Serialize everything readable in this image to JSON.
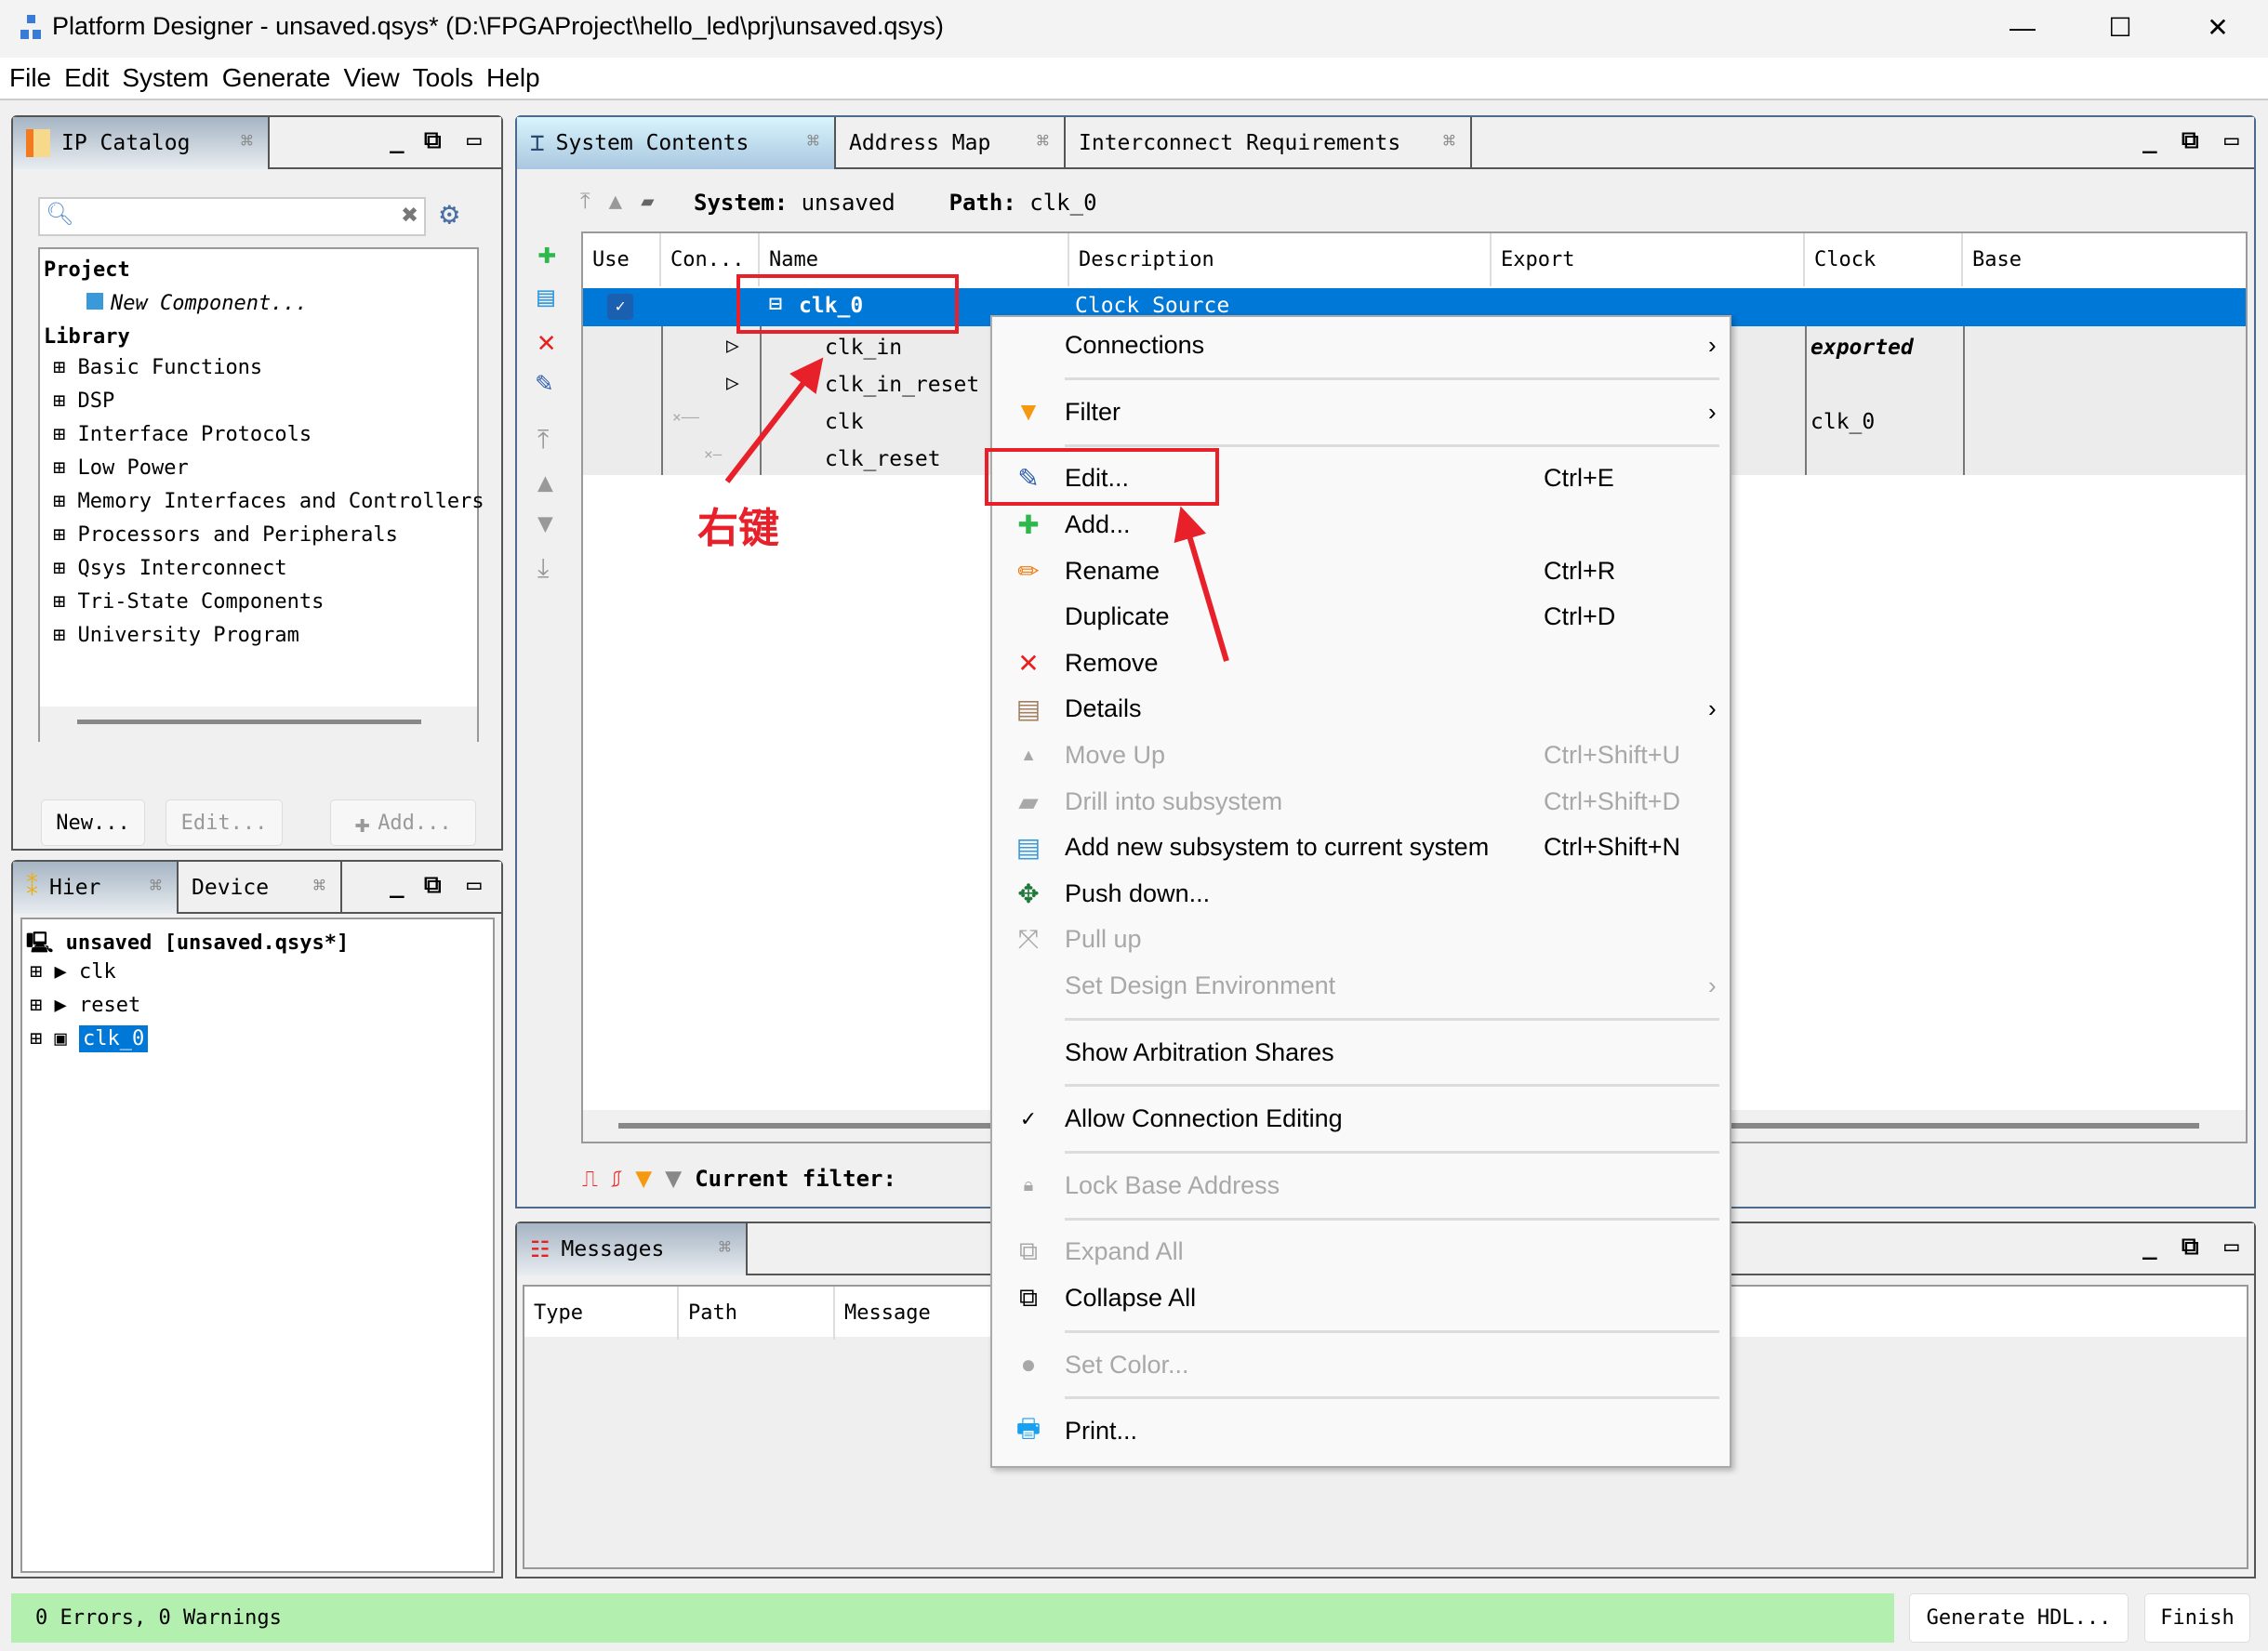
{
  "window": {
    "title": "Platform Designer - unsaved.qsys* (D:\\FPGAProject\\hello_led\\prj\\unsaved.qsys)",
    "minimize": "—",
    "maximize": "☐",
    "close": "✕"
  },
  "menubar": [
    "File",
    "Edit",
    "System",
    "Generate",
    "View",
    "Tools",
    "Help"
  ],
  "ip_catalog": {
    "tab": "IP Catalog",
    "search_placeholder": "",
    "tree": [
      {
        "label": "Project",
        "bold": true
      },
      {
        "label": "New Component...",
        "italic": true
      },
      {
        "label": "Library",
        "bold": true
      },
      {
        "label": "Basic Functions"
      },
      {
        "label": "DSP"
      },
      {
        "label": "Interface Protocols"
      },
      {
        "label": "Low Power"
      },
      {
        "label": "Memory Interfaces and Controllers"
      },
      {
        "label": "Processors and Peripherals"
      },
      {
        "label": "Qsys Interconnect"
      },
      {
        "label": "Tri-State Components"
      },
      {
        "label": "University Program"
      }
    ],
    "buttons": {
      "new": "New...",
      "edit": "Edit...",
      "add": "Add..."
    }
  },
  "hierarchy": {
    "tabs": [
      "Hier",
      "Device"
    ],
    "root": "unsaved [unsaved.qsys*]",
    "items": [
      "clk",
      "reset",
      "clk_0"
    ],
    "selected": "clk_0"
  },
  "system_contents": {
    "tabs": [
      "System Contents",
      "Address Map",
      "Interconnect Requirements"
    ],
    "system_label": "System:",
    "system_value": "unsaved",
    "path_label": "Path:",
    "path_value": "clk_0",
    "columns": [
      "Use",
      "Con...",
      "Name",
      "Description",
      "Export",
      "Clock",
      "Base"
    ],
    "rows": [
      {
        "name": "clk_0",
        "description": "Clock Source",
        "export": "",
        "clock": "",
        "selected": true,
        "use": true
      },
      {
        "name": "clk_in",
        "description": "",
        "export": "",
        "clock": "exported"
      },
      {
        "name": "clk_in_reset",
        "description": "",
        "export": "",
        "clock": ""
      },
      {
        "name": "clk",
        "description": "",
        "export": "",
        "clock": "clk_0"
      },
      {
        "name": "clk_reset",
        "description": "",
        "export": "",
        "clock": ""
      }
    ],
    "filter_label": "Current filter:"
  },
  "messages": {
    "tab": "Messages",
    "columns": [
      "Type",
      "Path",
      "Message"
    ]
  },
  "status": {
    "text": "0 Errors, 0 Warnings",
    "generate": "Generate HDL...",
    "finish": "Finish",
    "color": "#b3f0b0"
  },
  "context_menu": [
    {
      "label": "Connections",
      "submenu": true
    },
    {
      "sep": true
    },
    {
      "label": "Filter",
      "submenu": true,
      "icon": "filter-icon"
    },
    {
      "sep": true
    },
    {
      "label": "Edit...",
      "shortcut": "Ctrl+E",
      "icon": "edit-icon"
    },
    {
      "label": "Add...",
      "icon": "add-icon"
    },
    {
      "label": "Rename",
      "shortcut": "Ctrl+R",
      "icon": "pencil-icon"
    },
    {
      "label": "Duplicate",
      "shortcut": "Ctrl+D"
    },
    {
      "label": "Remove",
      "icon": "remove-icon"
    },
    {
      "label": "Details",
      "submenu": true,
      "icon": "details-icon"
    },
    {
      "label": "Move Up",
      "shortcut": "Ctrl+Shift+U",
      "disabled": true,
      "icon": "move-up-icon"
    },
    {
      "label": "Drill into subsystem",
      "shortcut": "Ctrl+Shift+D",
      "disabled": true,
      "icon": "drill-icon"
    },
    {
      "label": "Add new subsystem to current system",
      "shortcut": "Ctrl+Shift+N",
      "icon": "add-subsystem-icon"
    },
    {
      "label": "Push down...",
      "icon": "push-down-icon"
    },
    {
      "label": "Pull up",
      "disabled": true,
      "icon": "pull-up-icon"
    },
    {
      "label": "Set Design Environment",
      "submenu": true,
      "disabled": true
    },
    {
      "sep": true
    },
    {
      "label": "Show Arbitration Shares"
    },
    {
      "sep": true
    },
    {
      "label": "Allow Connection Editing",
      "checked": true
    },
    {
      "sep": true
    },
    {
      "label": "Lock Base Address",
      "disabled": true,
      "icon": "lock-icon"
    },
    {
      "sep": true
    },
    {
      "label": "Expand All",
      "disabled": true,
      "icon": "expand-all-icon"
    },
    {
      "label": "Collapse All",
      "icon": "collapse-all-icon"
    },
    {
      "sep": true
    },
    {
      "label": "Set Color...",
      "disabled": true,
      "icon": "color-icon"
    },
    {
      "sep": true
    },
    {
      "label": "Print...",
      "icon": "print-icon"
    }
  ],
  "annotation": {
    "text": "右键",
    "color": "#e8202a"
  }
}
